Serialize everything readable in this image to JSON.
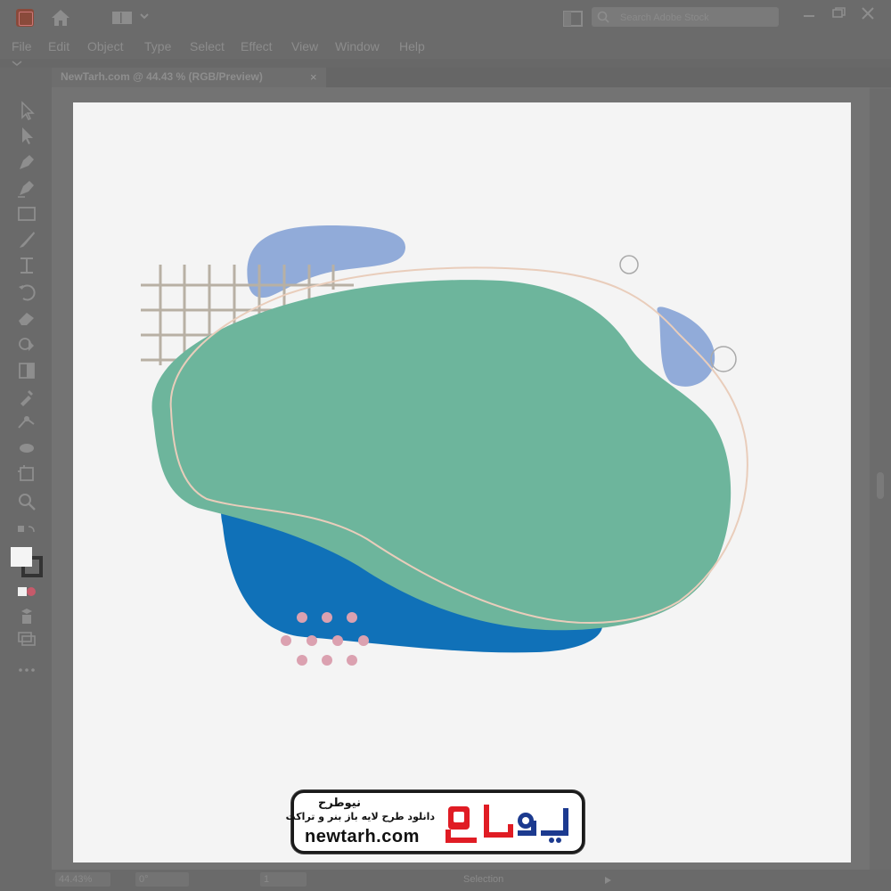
{
  "app": {
    "search_placeholder": "Search Adobe Stock"
  },
  "menu": {
    "items": [
      "File",
      "Edit",
      "Object",
      "Type",
      "Select",
      "Effect",
      "View",
      "Window",
      "Help"
    ]
  },
  "document": {
    "tab_title": "NewTarh.com @ 44.43 % (RGB/Preview)",
    "close_symbol": "×"
  },
  "status": {
    "zoom": "44.43%",
    "rotation": "0°",
    "artboard_index": "1",
    "tool": "Selection"
  },
  "badge": {
    "brand_fa": "نیوطرح",
    "tagline_fa": "دانلود طرح لایه باز بنر و تراکت",
    "url": "newtarh.com"
  },
  "colors": {
    "green_blob": "#6db59c",
    "blue_blob": "#1071b8",
    "light_blue_blob": "#91abd9",
    "grid_lines": "#b8b0a4",
    "outline": "#e9cdbb",
    "dots": "#dba1b0",
    "circles": "#a9a9a9",
    "logo_red": "#e01c24",
    "logo_blue": "#1c3a8f"
  },
  "icons": {
    "toolbar": [
      "selection-icon",
      "direct-selection-icon",
      "pen-icon",
      "curvature-icon",
      "rectangle-icon",
      "brush-icon",
      "width-icon",
      "rotate-icon",
      "eraser-icon",
      "shape-builder-icon",
      "gradient-icon",
      "eyedropper-icon",
      "blend-icon",
      "symbol-sprayer-icon",
      "artboard-icon",
      "zoom-icon",
      "swap-colors-icon",
      "fill-stroke-icon",
      "draw-mode-icon",
      "screen-mode-icon",
      "more-tools-icon"
    ]
  }
}
